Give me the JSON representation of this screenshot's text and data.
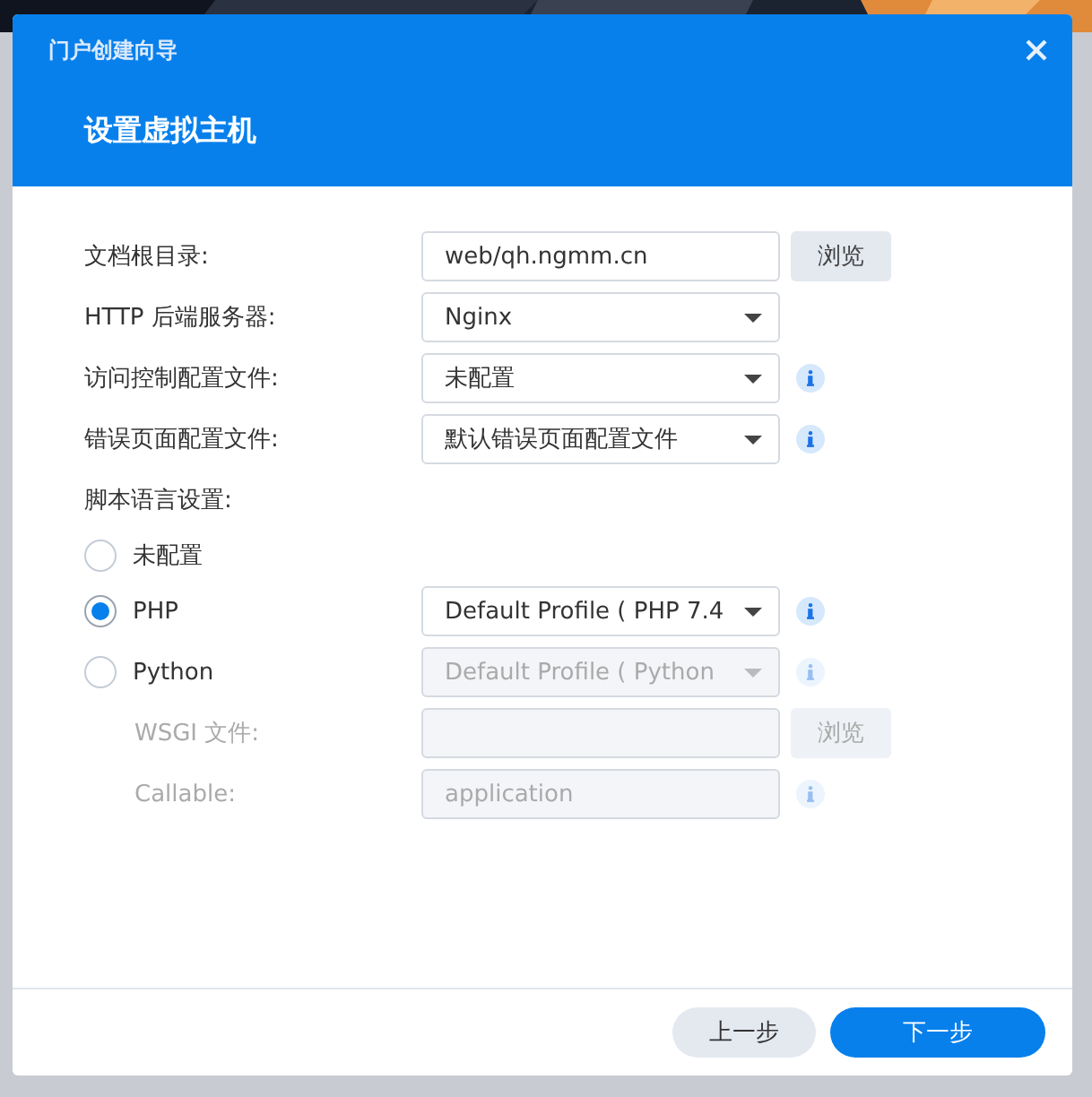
{
  "dialog": {
    "title": "门户创建向导",
    "heading": "设置虚拟主机"
  },
  "rows": [
    {
      "kind": "path",
      "label": "文档根目录:",
      "value": "web/qh.ngmm.cn",
      "button": "浏览",
      "disabled": false
    },
    {
      "kind": "select",
      "label": "HTTP 后端服务器:",
      "value": "Nginx",
      "info": false,
      "disabled": false
    },
    {
      "kind": "select",
      "label": "访问控制配置文件:",
      "value": "未配置",
      "info": true,
      "disabled": false
    },
    {
      "kind": "select",
      "label": "错误页面配置文件:",
      "value": "默认错误页面配置文件",
      "info": true,
      "disabled": false
    },
    {
      "kind": "section",
      "label": "脚本语言设置:"
    },
    {
      "kind": "radio",
      "label": "未配置",
      "selected": false
    },
    {
      "kind": "radio",
      "label": "PHP",
      "selected": true,
      "value": "Default Profile ( PHP 7.4",
      "info": true,
      "disabled": false
    },
    {
      "kind": "radio",
      "label": "Python",
      "selected": false,
      "value": "Default Profile ( Python",
      "info": true,
      "disabled": true,
      "children": [
        {
          "kind": "path",
          "label": "WSGI 文件:",
          "button": "浏览",
          "disabled": true
        },
        {
          "kind": "text",
          "label": "Callable:",
          "value": "application",
          "info": true,
          "disabled": true
        }
      ]
    }
  ],
  "footer": [
    {
      "label": "上一步",
      "kind": "secondary"
    },
    {
      "label": "下一步",
      "kind": "primary"
    }
  ]
}
